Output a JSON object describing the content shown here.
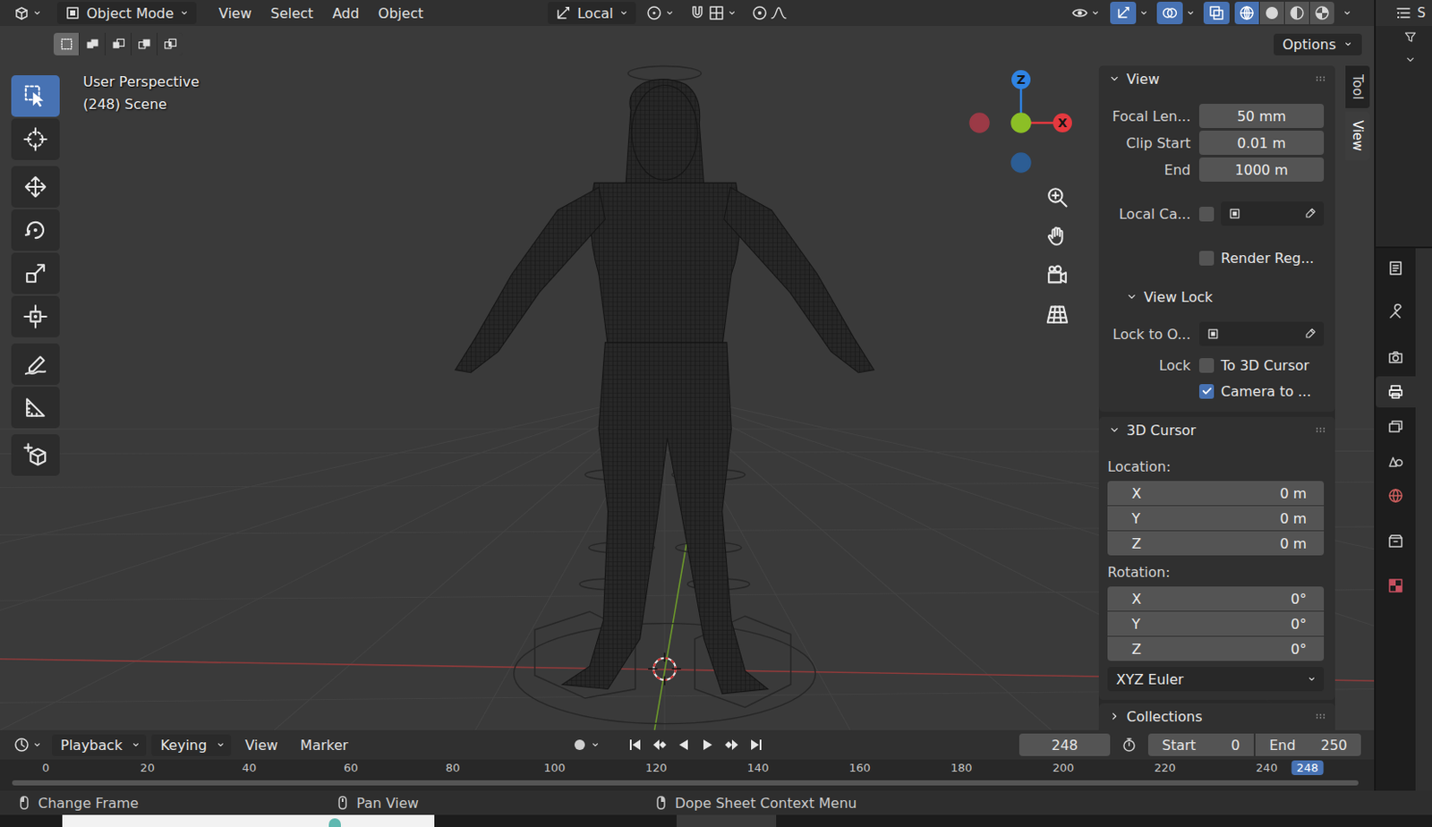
{
  "header": {
    "editor_type": "view3d",
    "mode": "Object Mode",
    "menus": [
      "View",
      "Select",
      "Add",
      "Object"
    ],
    "orientation": "Local",
    "snap_on": false,
    "proportional_on": false,
    "gizmos_on": true,
    "overlays_on": true,
    "xray_on": true,
    "shading": [
      {
        "kind": "wireframe",
        "selected": true
      },
      {
        "kind": "solid",
        "selected": false
      },
      {
        "kind": "material",
        "selected": false
      },
      {
        "kind": "rendered",
        "selected": false
      }
    ]
  },
  "tool_settings": {
    "select_modes": [
      {
        "kind": "set",
        "selected": true
      },
      {
        "kind": "extend",
        "selected": false
      },
      {
        "kind": "subtract",
        "selected": false
      },
      {
        "kind": "invert",
        "selected": false
      },
      {
        "kind": "intersect",
        "selected": false
      }
    ],
    "options": "Options"
  },
  "toolbar_groups": [
    {
      "tools": [
        {
          "kind": "select",
          "selected": true
        },
        {
          "kind": "cursor",
          "selected": false
        }
      ]
    },
    {
      "tools": [
        {
          "kind": "move",
          "selected": false
        },
        {
          "kind": "rotate",
          "selected": false
        },
        {
          "kind": "scale",
          "selected": false
        },
        {
          "kind": "transform",
          "selected": false
        }
      ]
    },
    {
      "tools": [
        {
          "kind": "annotate",
          "selected": false
        },
        {
          "kind": "measure",
          "selected": false
        }
      ]
    },
    {
      "tools": [
        {
          "kind": "addcube",
          "selected": false
        }
      ]
    }
  ],
  "viewport": {
    "view_name": "User Perspective",
    "frame_info": "(248) Scene"
  },
  "gizmo": [
    {
      "kind": "negx",
      "label": "",
      "color": "#9b3a46"
    },
    {
      "kind": "negz",
      "label": "",
      "color": "#2c5d94"
    },
    {
      "kind": "posz",
      "label": "Z",
      "color": "#2f83e3"
    },
    {
      "kind": "posx",
      "label": "X",
      "color": "#e4393f"
    },
    {
      "kind": "posy",
      "label": "",
      "color": "#8cbf26"
    }
  ],
  "nav_buttons": [
    {
      "kind": "zoom"
    },
    {
      "kind": "pan"
    },
    {
      "kind": "camera"
    },
    {
      "kind": "ortho"
    }
  ],
  "sidebar": {
    "tabs": [
      {
        "label": "Tool",
        "selected": false
      },
      {
        "label": "View",
        "selected": true
      }
    ],
    "view_panel": {
      "title": "View",
      "expanded": true,
      "fields": [
        {
          "label": "Focal Len...",
          "value": "50 mm"
        },
        {
          "label": "Clip Start",
          "value": "0.01 m"
        },
        {
          "label": "End",
          "value": "1000 m"
        }
      ],
      "local_camera": {
        "label": "Local Ca...",
        "checked": false
      },
      "render_region": {
        "label": "Render Reg...",
        "checked": false
      },
      "view_lock": {
        "title": "View Lock",
        "expanded": true,
        "lock_object_label": "Lock to O...",
        "lock_label": "Lock",
        "options": [
          {
            "label": "To 3D Cursor",
            "checked": false
          },
          {
            "label": "Camera to ...",
            "checked": true
          }
        ]
      }
    },
    "cursor_panel": {
      "title": "3D Cursor",
      "expanded": true,
      "location_label": "Location:",
      "location": [
        {
          "axis": "X",
          "value": "0 m"
        },
        {
          "axis": "Y",
          "value": "0 m"
        },
        {
          "axis": "Z",
          "value": "0 m"
        }
      ],
      "rotation_label": "Rotation:",
      "rotation": [
        {
          "axis": "X",
          "value": "0°"
        },
        {
          "axis": "Y",
          "value": "0°"
        },
        {
          "axis": "Z",
          "value": "0°"
        }
      ],
      "rotation_mode": "XYZ Euler"
    },
    "collections_panel": {
      "title": "Collections",
      "expanded": false
    }
  },
  "timeline": {
    "editor_type": "timeline",
    "menus": [
      {
        "label": "Playback",
        "kind": "dropdown"
      },
      {
        "label": "Keying",
        "kind": "dropdown"
      },
      {
        "label": "View",
        "kind": "menu"
      },
      {
        "label": "Marker",
        "kind": "menu"
      }
    ],
    "auto_keying": false,
    "transport": [
      {
        "kind": "jump-start"
      },
      {
        "kind": "key-prev"
      },
      {
        "kind": "play-reverse"
      },
      {
        "kind": "play"
      },
      {
        "kind": "key-next"
      },
      {
        "kind": "jump-end"
      }
    ],
    "current_frame": "248",
    "start_label": "Start",
    "start": "0",
    "end_label": "End",
    "end": "250",
    "ruler": [
      "0",
      "20",
      "40",
      "60",
      "80",
      "100",
      "120",
      "140",
      "160",
      "180",
      "200",
      "220",
      "240"
    ],
    "playhead": "248"
  },
  "outliner": {
    "editor_type": "outliner",
    "header_text": "S"
  },
  "properties": {
    "editor_type": "properties",
    "tab_groups": [
      {
        "tabs": [
          {
            "kind": "tool",
            "selected": false
          }
        ]
      },
      {
        "tabs": [
          {
            "kind": "render",
            "selected": false
          },
          {
            "kind": "output",
            "selected": true
          },
          {
            "kind": "viewlayer",
            "selected": false
          },
          {
            "kind": "scene",
            "selected": false
          },
          {
            "kind": "world",
            "selected": false
          }
        ]
      },
      {
        "tabs": [
          {
            "kind": "collection",
            "selected": false
          }
        ]
      },
      {
        "tabs": [
          {
            "kind": "texture",
            "selected": false
          }
        ]
      }
    ]
  },
  "status_bar": {
    "hints": [
      {
        "kind": "mouse-left",
        "label": "Change Frame"
      },
      {
        "kind": "mouse-middle",
        "label": "Pan View"
      },
      {
        "kind": "mouse-right",
        "label": "Dope Sheet Context Menu"
      }
    ]
  }
}
